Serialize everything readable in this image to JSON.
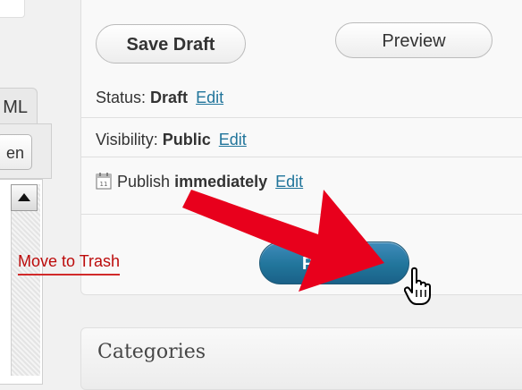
{
  "editor": {
    "tab_html_label": "ML",
    "fullscreen_label": "en"
  },
  "publish": {
    "save_draft_label": "Save Draft",
    "preview_label": "Preview",
    "status_label": "Status:",
    "status_value": "Draft",
    "status_edit": "Edit",
    "visibility_label": "Visibility:",
    "visibility_value": "Public",
    "visibility_edit": "Edit",
    "publish_label": "Publish",
    "publish_value": "immediately",
    "publish_edit": "Edit",
    "trash_label": "Move to Trash",
    "publish_button_label": "Publish"
  },
  "categories": {
    "title": "Categories"
  },
  "colors": {
    "link": "#21759b",
    "trash": "#bc0b0b",
    "publish_button": "#21759b",
    "annotation_arrow": "#e8001c"
  },
  "icons": [
    "calendar-icon",
    "scroll-up-arrow-icon",
    "hand-pointer-cursor-icon",
    "red-arrow-annotation"
  ]
}
